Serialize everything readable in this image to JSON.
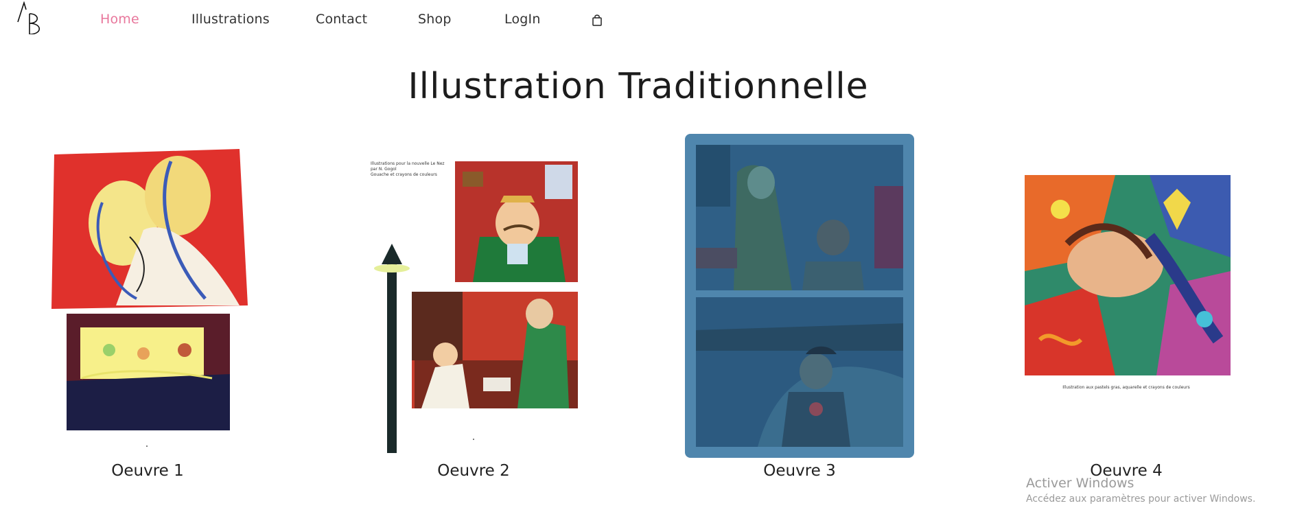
{
  "logo": {
    "text": "AB"
  },
  "nav": {
    "items": [
      {
        "label": "Home",
        "active": true
      },
      {
        "label": "Illustrations",
        "active": false
      },
      {
        "label": "Contact",
        "active": false
      },
      {
        "label": "Shop",
        "active": false
      },
      {
        "label": "LogIn",
        "active": false
      }
    ],
    "cart_icon": "shopping-bag-icon"
  },
  "page": {
    "title": "Illustration Traditionnelle"
  },
  "gallery": {
    "items": [
      {
        "label": "Oeuvre 1"
      },
      {
        "label": "Oeuvre 2",
        "caption_lines": [
          "Illustrations pour la nouvelle Le Nez",
          "par N. Gogol",
          "Gouache et crayons de couleurs"
        ]
      },
      {
        "label": "Oeuvre 3",
        "hovered": true
      },
      {
        "label": "Oeuvre 4",
        "caption": "Illustration aux pastels gras, aquarelle et crayons de couleurs"
      }
    ]
  },
  "system_watermark": {
    "line1": "Activer Windows",
    "line2": "Accédez aux paramètres pour activer Windows."
  },
  "colors": {
    "nav_active": "#e8779c",
    "hover_overlay": "#4f86ad"
  }
}
